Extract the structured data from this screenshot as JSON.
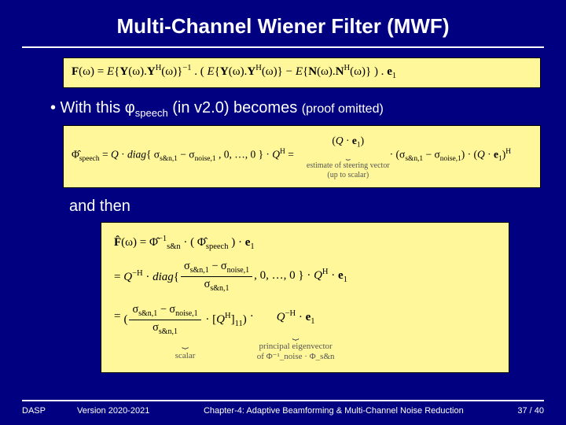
{
  "title": "Multi-Channel Wiener Filter (MWF)",
  "eq1": "F(ω) = E{Y(ω).Yᴴ(ω)}⁻¹ . ( E{Y(ω).Yᴴ(ω)} − E{N(ω).Nᴴ(ω)} ) . e₁",
  "bullet": {
    "prefix": "•  With this ",
    "phi": "φ",
    "phisub": "speech",
    "mid": " (in v2.0) becomes ",
    "proof": "(proof omitted)"
  },
  "eq2": {
    "lhs": "Φ̂_speech = Q · diag{ σ_s&n,1 − σ_noise,1 , 0, …, 0 } · Qᴴ =",
    "group_expr": "(Q · e₁)",
    "group_label1": "estimate of steering vector",
    "group_label2": "(up to scalar)",
    "tail": " · (σ_s&n,1 − σ_noise,1) · (Q · e₁)ᴴ"
  },
  "andthen": "and then",
  "eq3": {
    "line1": "F̂(ω) = Φ̂⁻¹_s&n · (Φ̂_speech) · e₁",
    "line2_pre": "= Q⁻ᴴ · diag{",
    "line2_num": "σ_s&n,1 − σ_noise,1",
    "line2_den": "σ_s&n,1",
    "line2_post": " , 0, …, 0 } · Qᴴ · e₁",
    "line3_pre": "= ",
    "scalar_num": "σ_s&n,1 − σ_noise,1",
    "scalar_den": "σ_s&n,1",
    "scalar_mult": " · [Qᴴ]₁₁",
    "scalar_label": "scalar",
    "dot": " · ",
    "eig_expr": "Q⁻ᴴ · e₁",
    "eig_label1": "principal eigenvector",
    "eig_label2": "of Φ⁻¹_noise · Φ_s&n"
  },
  "footer": {
    "left": "DASP",
    "version": "Version 2020-2021",
    "chapter": "Chapter-4: Adaptive Beamforming & Multi-Channel Noise Reduction",
    "page": "37 / 40"
  }
}
